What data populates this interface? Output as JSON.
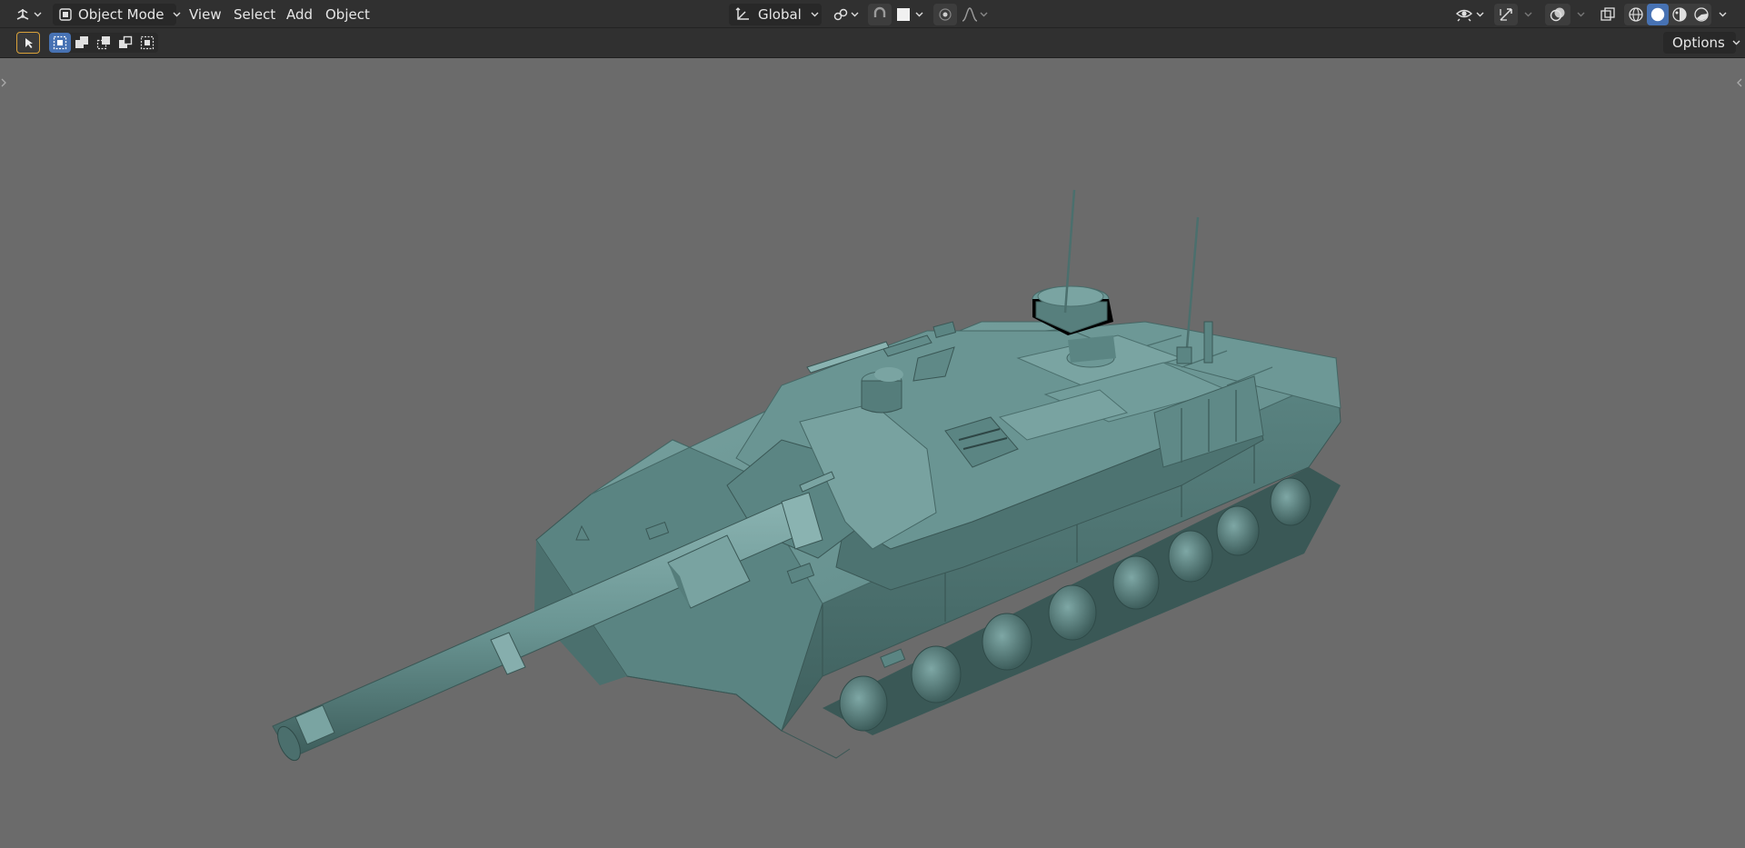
{
  "header": {
    "editor_type_icon": "editor-type-3d-viewport-icon",
    "mode_selector": {
      "icon": "object-mode-icon",
      "label": "Object Mode"
    },
    "menus": [
      "View",
      "Select",
      "Add",
      "Object"
    ],
    "transform_orientation": {
      "icon": "transform-orientation-icon",
      "label": "Global"
    },
    "pivot_icon": "pivot-point-icon",
    "snap_icon": "snap-magnet-icon",
    "snap_target_icon": "snap-increment-icon",
    "proportional_icon": "proportional-editing-icon",
    "falloff_icon": "falloff-curve-icon",
    "visibility_icon": "object-visibility-icon",
    "gizmo_icon": "gizmo-icon",
    "overlay_icon": "overlay-icon",
    "xray_icon": "xray-icon",
    "shading_modes": [
      {
        "name": "wireframe",
        "icon": "wireframe-shading-icon",
        "active": false
      },
      {
        "name": "solid",
        "icon": "solid-shading-icon",
        "active": true
      },
      {
        "name": "material",
        "icon": "material-preview-icon",
        "active": false
      },
      {
        "name": "rendered",
        "icon": "rendered-shading-icon",
        "active": false
      }
    ]
  },
  "toolbar": {
    "active_tool_icon": "select-box-tool-icon",
    "selection_modes": [
      {
        "name": "new",
        "icon": "select-new-icon",
        "active": true
      },
      {
        "name": "extend",
        "icon": "select-extend-icon",
        "active": false
      },
      {
        "name": "subtract",
        "icon": "select-subtract-icon",
        "active": false
      },
      {
        "name": "invert",
        "icon": "select-invert-icon",
        "active": false
      },
      {
        "name": "intersect",
        "icon": "select-intersect-icon",
        "active": false
      }
    ],
    "options_label": "Options"
  },
  "viewport": {
    "background_color": "#6b6b6b",
    "model_color": "#6a9593",
    "model_subject": "tank-model"
  },
  "colors": {
    "header_bg": "#303030",
    "accent_blue": "#4772b3",
    "tool_outline": "#d9a23a"
  }
}
